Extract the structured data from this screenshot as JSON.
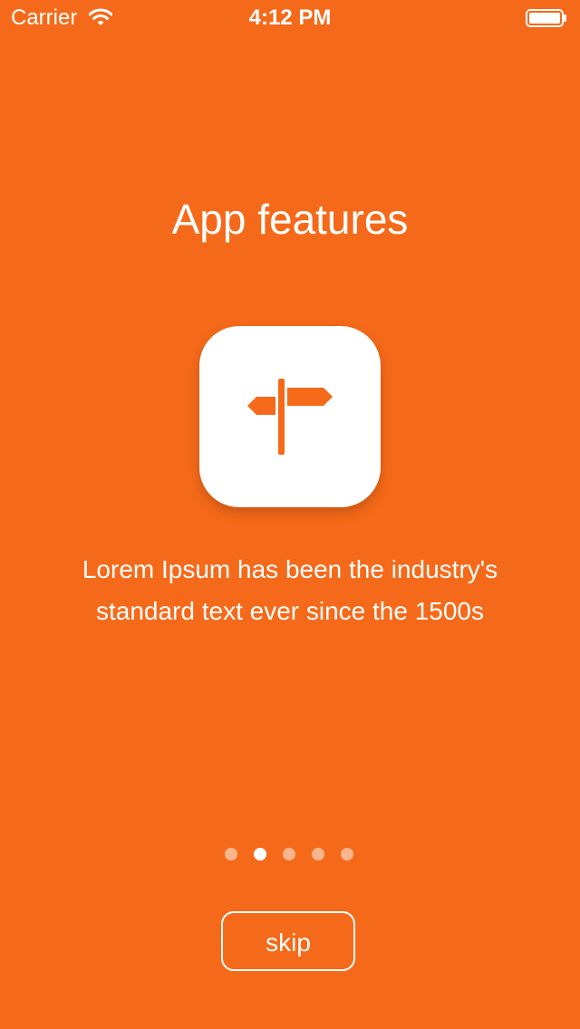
{
  "status_bar": {
    "carrier": "Carrier",
    "time": "4:12 PM",
    "wifi_icon": "wifi-icon",
    "battery_icon": "battery-full-icon"
  },
  "onboarding": {
    "title": "App features",
    "icon": "signpost-icon",
    "description": "Lorem Ipsum has been the industry's standard text ever since the 1500s",
    "page_count": 5,
    "current_page": 2
  },
  "skip_button": {
    "label": "skip"
  },
  "colors": {
    "background": "#F56A1A",
    "foreground": "#FFFFFF",
    "icon_tile": "#FFFFFF",
    "icon_glyph": "#F56A1A"
  }
}
